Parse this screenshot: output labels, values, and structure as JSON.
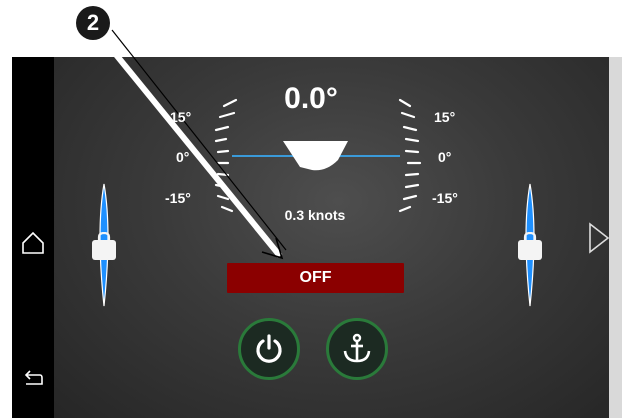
{
  "callout": {
    "number": "2"
  },
  "trim": {
    "angle": "0.0°",
    "left_labels": [
      "15°",
      "0°",
      "-15°"
    ],
    "right_labels": [
      "15°",
      "0°",
      "-15°"
    ],
    "speed": "0.3 knots"
  },
  "status": {
    "label": "OFF",
    "color": "#8b0000"
  },
  "buttons": {
    "power_icon": "power-icon",
    "anchor_icon": "anchor-icon"
  },
  "nav": {
    "home_icon": "home-icon",
    "back_icon": "back-icon",
    "next_icon": "play-triangle-icon"
  },
  "colors": {
    "tab_blue": "#1e90ff",
    "ring_green": "#2a7a3a",
    "horizon_line": "#3a9ad9"
  }
}
